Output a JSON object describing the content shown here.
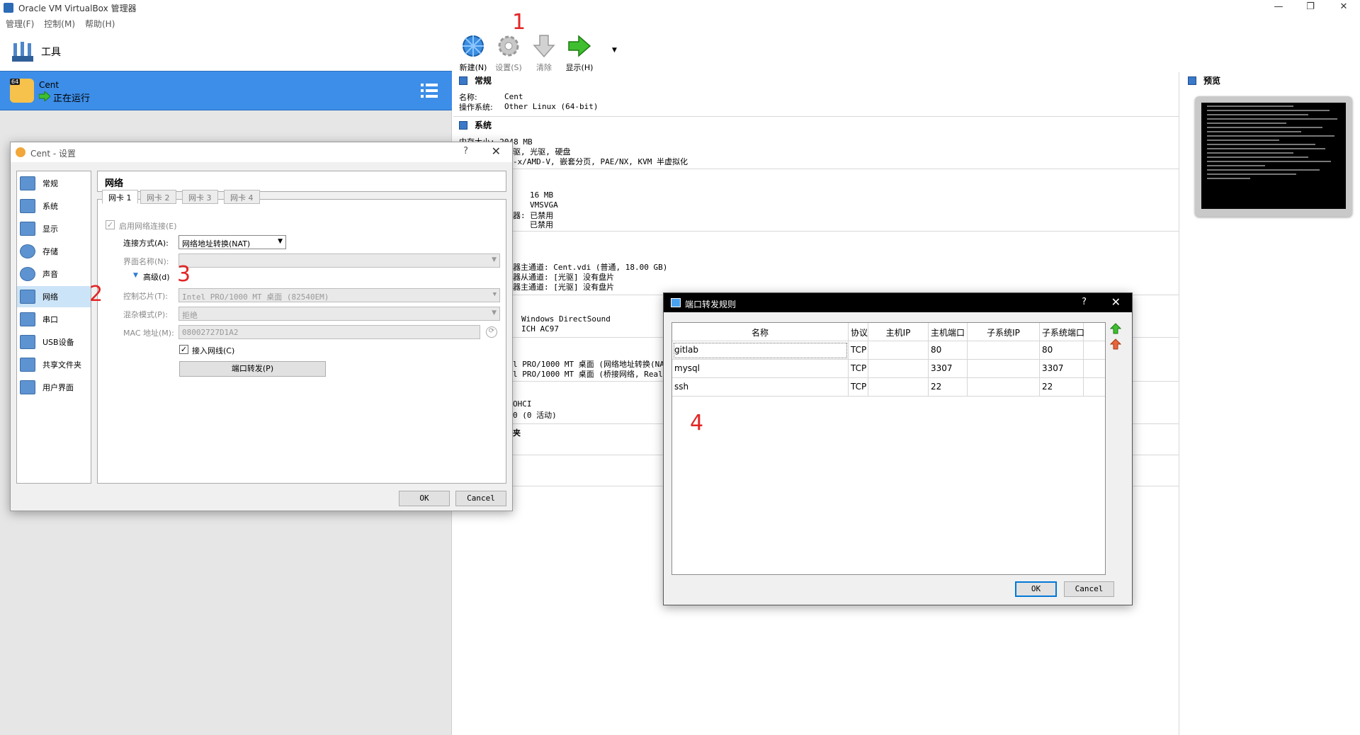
{
  "window": {
    "title": "Oracle VM VirtualBox 管理器"
  },
  "menu": [
    "管理(F)",
    "控制(M)",
    "帮助(H)"
  ],
  "tools": {
    "label": "工具"
  },
  "vm": {
    "bits": "64",
    "name": "Cent",
    "state": "正在运行"
  },
  "toolbar": {
    "new": "新建(N)",
    "settings": "设置(S)",
    "discard": "清除",
    "show": "显示(H)"
  },
  "details": {
    "general": {
      "title": "常规",
      "name_label": "名称:",
      "name_value": "Cent",
      "os_label": "操作系统:",
      "os_value": "Other Linux (64-bit)"
    },
    "system": {
      "title": "系统",
      "memory": "内存大小:    2048 MB",
      "boot": "驱, 光驱, 硬盘",
      "accel": "-x/AMD-V, 嵌套分页, PAE/NX, KVM 半虚拟化"
    },
    "display": {
      "vram": "16 MB",
      "controller": "VMSVGA",
      "rdp": "器:   已禁用",
      "record": "已禁用"
    },
    "storage": {
      "line1": "器主通道:   Cent.vdi (普通, 18.00 GB)",
      "line2": "器从通道:   [光驱] 没有盘片",
      "line3": "器主通道:   [光驱] 没有盘片"
    },
    "audio": {
      "driver": "Windows DirectSound",
      "controller": "ICH AC97"
    },
    "network": {
      "line1": "l PRO/1000 MT 桌面 (网络地址转换(NAT",
      "line2": "l PRO/1000 MT 桌面 (桥接网络, Realt"
    },
    "usb": {
      "line1": "OHCI",
      "line2": "0 (0 活动)"
    },
    "shared": {
      "title": "夹"
    }
  },
  "preview": {
    "title": "预览"
  },
  "settings_dialog": {
    "title": "Cent - 设置",
    "help": "?",
    "close": "✕",
    "categories": [
      "常规",
      "系统",
      "显示",
      "存储",
      "声音",
      "网络",
      "串口",
      "USB设备",
      "共享文件夹",
      "用户界面"
    ],
    "selected_category": "网络",
    "pane_title": "网络",
    "tabs": [
      "网卡 1",
      "网卡 2",
      "网卡 3",
      "网卡 4"
    ],
    "enable_label": "启用网络连接(E)",
    "attach_label": "连接方式(A):",
    "attach_value": "网络地址转换(NAT)",
    "name_label": "界面名称(N):",
    "advanced_label": "高级(d)",
    "adapter_label": "控制芯片(T):",
    "adapter_value": "Intel PRO/1000 MT 桌面 (82540EM)",
    "promisc_label": "混杂模式(P):",
    "promisc_value": "拒绝",
    "mac_label": "MAC 地址(M):",
    "mac_value": "08002727D1A2",
    "cable_label": "接入网线(C)",
    "port_forward_button": "端口转发(P)",
    "ok": "OK",
    "cancel": "Cancel"
  },
  "port_forwarding_dialog": {
    "title": "端口转发规则",
    "help": "?",
    "close": "✕",
    "columns": [
      "名称",
      "协议",
      "主机IP",
      "主机端口",
      "子系统IP",
      "子系统端口"
    ],
    "rows": [
      [
        "gitlab",
        "TCP",
        "",
        "80",
        "",
        "80"
      ],
      [
        "mysql",
        "TCP",
        "",
        "3307",
        "",
        "3307"
      ],
      [
        "ssh",
        "TCP",
        "",
        "22",
        "",
        "22"
      ]
    ],
    "ok": "OK",
    "cancel": "Cancel"
  },
  "annotations": [
    "1",
    "2",
    "3",
    "4"
  ],
  "colors": {
    "vm_selected": "#3d8ee8",
    "annotation": "#e32525",
    "category_selected": "#cce4f7"
  }
}
